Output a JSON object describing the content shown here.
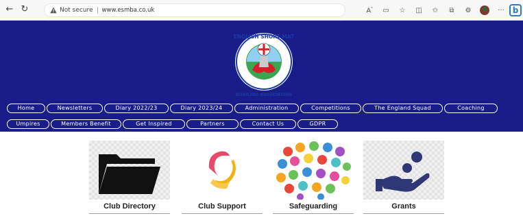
{
  "browser": {
    "back_icon": "back-arrow-icon",
    "reload_icon": "reload-icon",
    "security_label": "Not secure",
    "url": "www.esmba.co.uk"
  },
  "header": {
    "background": "#191d8a",
    "logo_top_text": "ENGLISH SHORT MAT",
    "logo_bottom_text": "BOWLING ASSOCIATION",
    "nav_row1": [
      "Home",
      "Newsletters",
      "Diary 2022/23",
      "Diary 2023/24",
      "Administration",
      "Competitions",
      "The England Squad",
      "Coaching"
    ],
    "nav_row2": [
      "Umpires",
      "Members Benefit",
      "Get Inspired",
      "Partners",
      "Contact Us",
      "GDPR"
    ]
  },
  "tiles": [
    {
      "label": "Club Directory",
      "icon": "folder-icon"
    },
    {
      "label": "Club Support",
      "icon": "support-icon"
    },
    {
      "label": "Safeguarding",
      "icon": "colorful-hands-icon"
    },
    {
      "label": "Grants",
      "icon": "hand-coins-icon"
    }
  ]
}
